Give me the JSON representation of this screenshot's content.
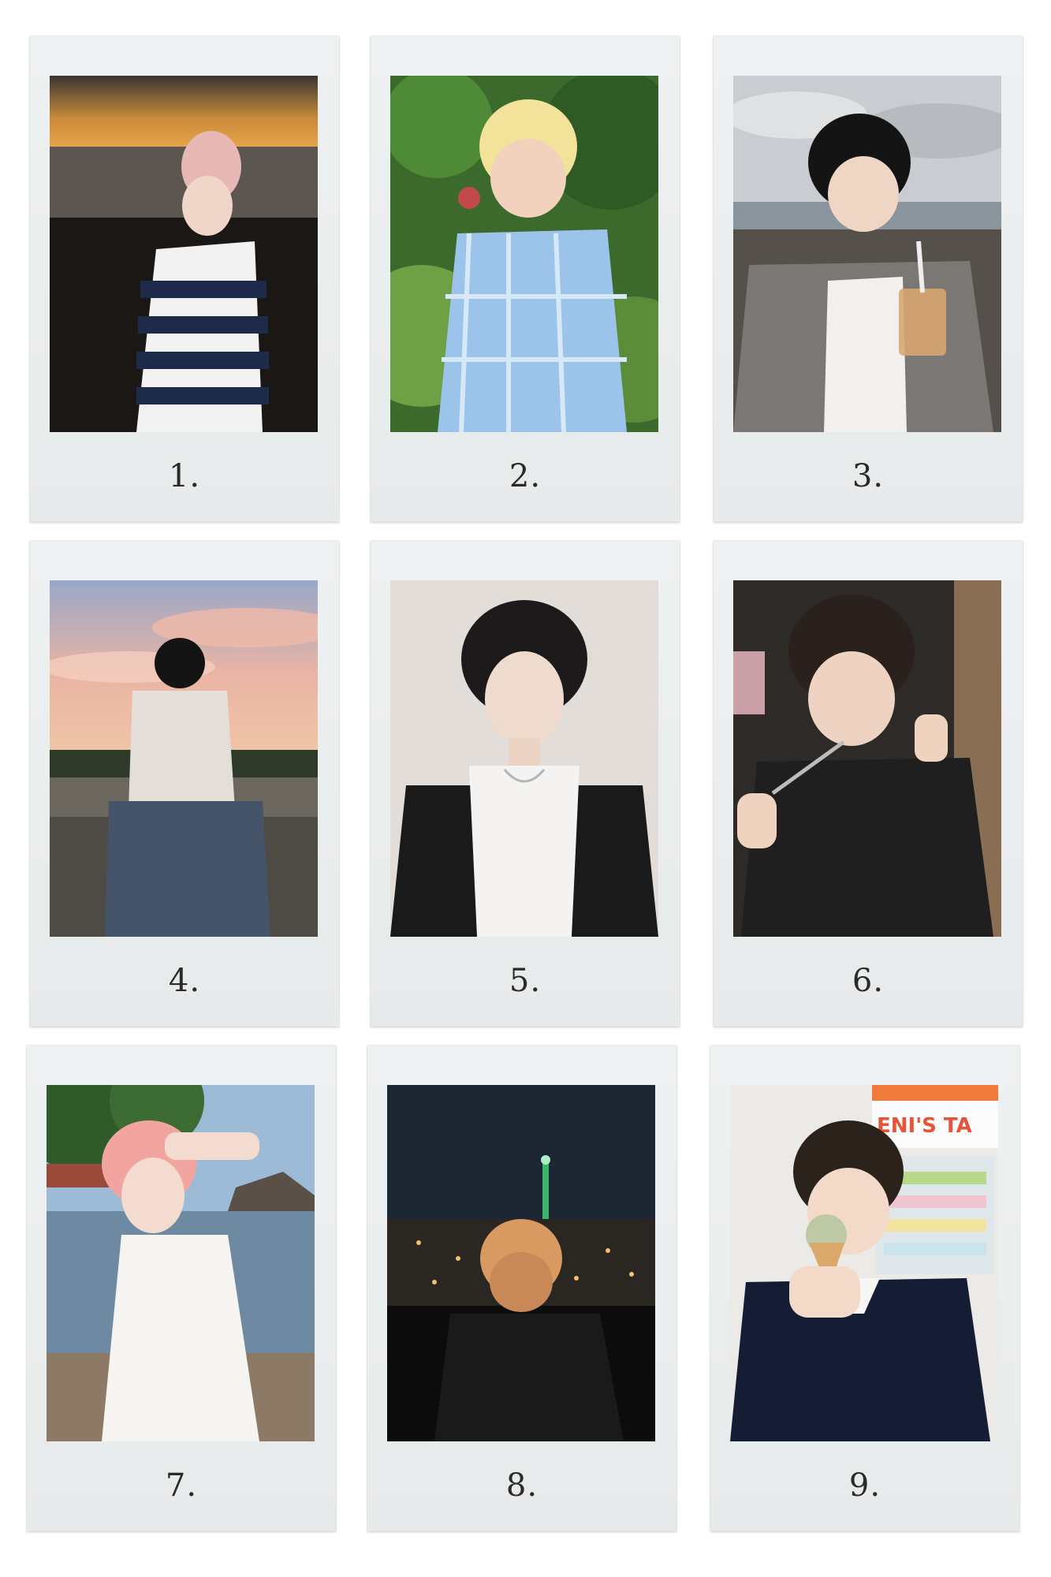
{
  "polaroids": [
    {
      "caption": "1.",
      "scene": "sunset-beach-striped-shirt"
    },
    {
      "caption": "2.",
      "scene": "forest-blonde-plaid-shirt"
    },
    {
      "caption": "3.",
      "scene": "rocky-beach-bubble-tea"
    },
    {
      "caption": "4.",
      "scene": "sunset-sky-sitting"
    },
    {
      "caption": "5.",
      "scene": "portrait-black-jacket"
    },
    {
      "caption": "6.",
      "scene": "thumbs-up-dessert"
    },
    {
      "caption": "7.",
      "scene": "seaside-white-shirt"
    },
    {
      "caption": "8.",
      "scene": "night-city-tower"
    },
    {
      "caption": "9.",
      "scene": "ice-cream-shop"
    }
  ],
  "shop_sign": "ENI'S TA"
}
